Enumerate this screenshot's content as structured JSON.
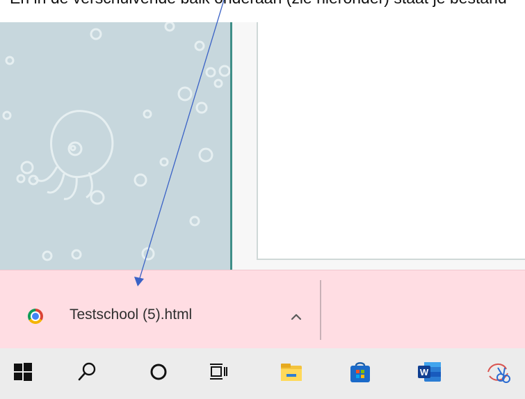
{
  "caption": {
    "text": "En in de verschuivende balk onderaan (zie hieronder) staat je bestand"
  },
  "download_bar": {
    "file_name": "Testschool (5).html",
    "icon": "chrome-icon",
    "expand_icon": "chevron-up-icon"
  },
  "taskbar": {
    "items": [
      {
        "name": "start",
        "icon": "windows-icon"
      },
      {
        "name": "search",
        "icon": "search-icon"
      },
      {
        "name": "cortana",
        "icon": "circle-icon"
      },
      {
        "name": "task-view",
        "icon": "task-view-icon"
      },
      {
        "name": "file-explorer",
        "icon": "folder-icon"
      },
      {
        "name": "store",
        "icon": "store-icon"
      },
      {
        "name": "word",
        "icon": "word-icon"
      },
      {
        "name": "snipping",
        "icon": "scissors-icon"
      }
    ]
  },
  "colors": {
    "download_bar_bg": "#ffdde3",
    "left_panel_bg": "#c7d7dd",
    "panel_border": "#3f8f88",
    "arrow": "#3a62c6"
  }
}
